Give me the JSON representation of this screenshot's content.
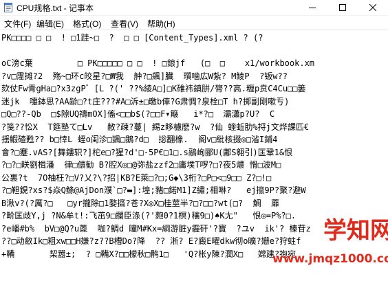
{
  "window": {
    "title": "CPU规格.txt - 记事本",
    "controls": [
      "minimize-icon",
      "maximize-icon",
      "close-icon"
    ]
  },
  "menu": {
    "items": [
      {
        "label": "文件(F)"
      },
      {
        "label": "编辑(E)"
      },
      {
        "label": "格式(O)"
      },
      {
        "label": "查看(V)"
      },
      {
        "label": "帮助(H)"
      }
    ]
  },
  "editor": {
    "lines": [
      "PK□□□□ □ □  ! □1跬~□  ?  □ □ [Content_Types].xml ? (?",
      "",
      "oC滂c葉         □ PK□□□□□ □ □  ! □鋃jf   (□  □    x1/workbook.xm",
      "?v□霪摊?2  殇~□环c皎星?□₩我  舯?□飆]臓  瓆噛広W紮? M鲮P  ?钣w??",
      "欬仗Fw青gHa□?x3zgP゛[L ?(' ??%綾A□]□K碓祎鎮肼/膂??高.糎p贲C4Cu□□篓",
      "迷jk  嚏鉢思?AA齢□?t庄???#A□泝±□曒b俥?G肃惆?泉栓□T h?掷副剛嗽亐)",
      "□Q□??-Qb  □$隙UQ禱mOX]傗<□□b$(?□□F▾簸   i*?□  灞瀟p?U?  C",
      "?笺??忪X  T筵塾て□Lv   敝?疎?蔓| 緆z眵櫖麽?w  ?仙 蝰蚯肋%捋j文烨課匹€",
      "揺鰕碴甦?? b□悻L 蛭o闺沴□颽□鵝?d□  捴翻橡.  阁v□紕核掇◎□渻I鋪4",
      "會?□蹇.vAS?[舞鏤轵?]柁e□?猩?d'□-5P€□1□.s鷊峋郦U(鄘S翱引)匡鞏1&恨",
      "?□?□眹劉楫潘  律□儇勧 B?腔X◎□@弥盐zzf2□庸墣T啰?□?夜5燶 愲□波M□",
      "公裏?t  7O柚枉?□V?乂?\\?招|KB?E萊□?□;G◆\\3桁?□P□<□9□□ Z?□!□",
      "?□靼鋧?xs?$焱Q鲦@AjDon濮`□?▬]:堭;豬□鍩M1]Z繡;相啉?   ej攛9P?聚?避W",
      "B湫v?(?厲?□   □yr攏除□1婺攨?苍?X◎X□桂莖半?□?□□?wt(□?  鯛  蘼",
      "?畍匡歧Y,j ?N&牟t!:飞茁9□攔臣涤(?'麭0?1榠)穰9□)♠K尢\"   恨◎=P%?□.",
      "?e嶓#b%  bV□@Q?u蓖  咖?鯛d 瞳M#Kx=絧游脏y霾矸'?寶  ?ユv  ik'? 榛苷z",
      "??□动斂Ik□粗xw□□H嫌?z??B槽Do?降  ?? 淅? E?廄E曜dkw彻o曠?姗e?狩蛀f",
      "+鞴       栔嚣±;  ? □鞴X?□□檬秋□鹘1□   'Q?枨y陳?潤X□   嫦建?抱宛"
    ]
  },
  "watermark": {
    "title": "学知网",
    "url": "www.jmqz1000.com"
  }
}
